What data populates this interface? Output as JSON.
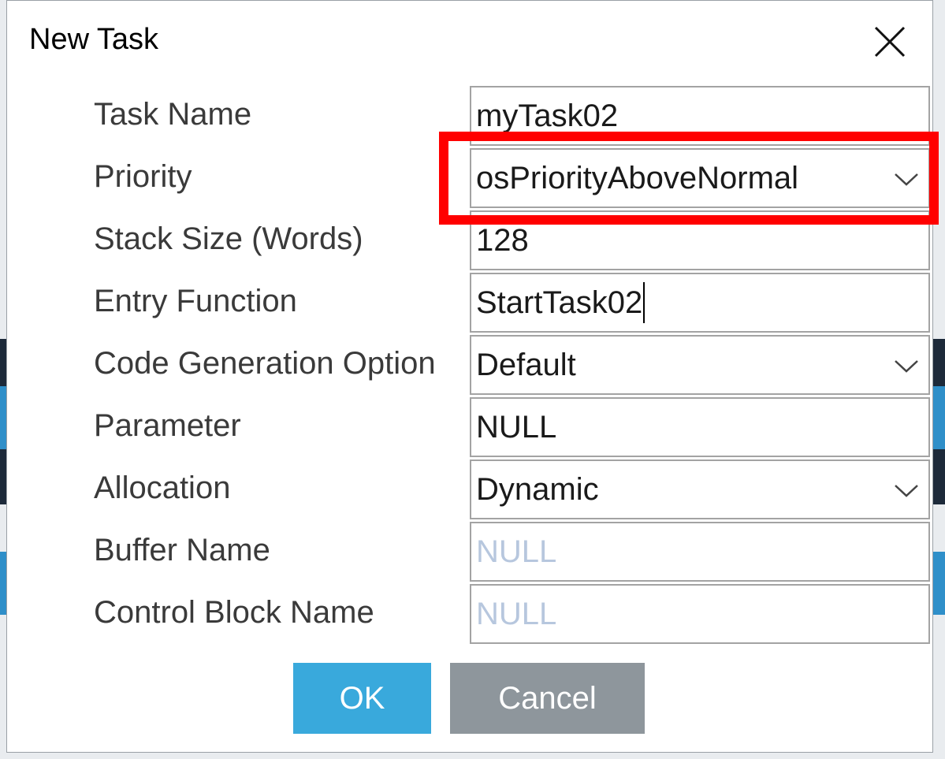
{
  "dialog": {
    "title": "New Task",
    "close_icon": "close-icon"
  },
  "fields": [
    {
      "key": "task_name",
      "label": "Task Name",
      "value": "myTask02",
      "type": "text",
      "placeholder": false
    },
    {
      "key": "priority",
      "label": "Priority",
      "value": "osPriorityAboveNormal",
      "type": "select",
      "placeholder": false
    },
    {
      "key": "stack_size",
      "label": "Stack Size (Words)",
      "value": "128",
      "type": "text",
      "placeholder": false
    },
    {
      "key": "entry_function",
      "label": "Entry Function",
      "value": "StartTask02",
      "type": "text",
      "placeholder": false
    },
    {
      "key": "code_generation_option",
      "label": "Code Generation Option",
      "value": "Default",
      "type": "select",
      "placeholder": false
    },
    {
      "key": "parameter",
      "label": "Parameter",
      "value": "NULL",
      "type": "text",
      "placeholder": false
    },
    {
      "key": "allocation",
      "label": "Allocation",
      "value": "Dynamic",
      "type": "select",
      "placeholder": false
    },
    {
      "key": "buffer_name",
      "label": "Buffer Name",
      "value": "NULL",
      "type": "text",
      "placeholder": true
    },
    {
      "key": "control_block_name",
      "label": "Control Block Name",
      "value": "NULL",
      "type": "text",
      "placeholder": true
    }
  ],
  "buttons": {
    "ok_label": "OK",
    "cancel_label": "Cancel"
  },
  "colors": {
    "ok_button": "#39a9dc",
    "cancel_button": "#8e969c",
    "highlight": "#ff0000",
    "placeholder_text": "#b7c7de"
  }
}
